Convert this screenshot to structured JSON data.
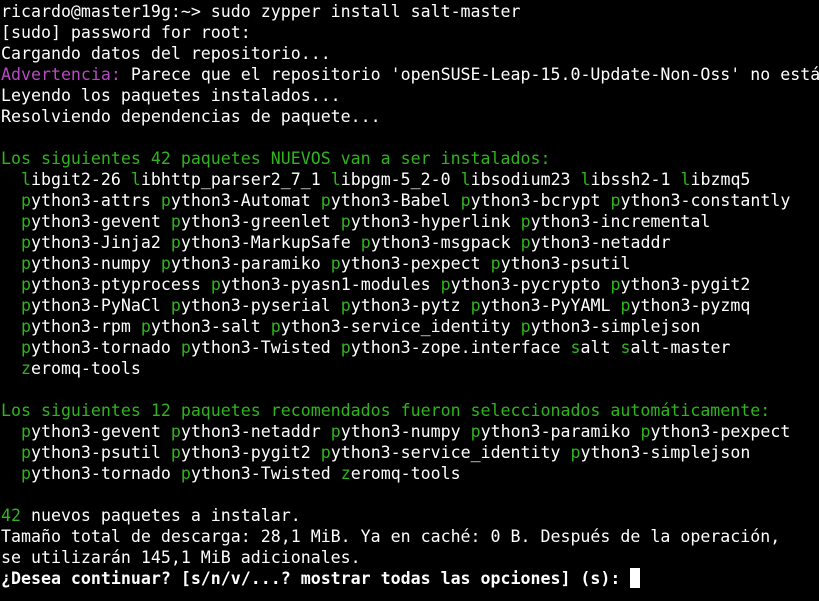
{
  "terminal": {
    "prompt_command": "ricardo@master19g:~> sudo zypper install salt-master",
    "sudo_prompt": "[sudo] password for root:",
    "loading_repo": "Cargando datos del repositorio...",
    "warning_label": "Advertencia:",
    "warning_text": " Parece que el repositorio 'openSUSE-Leap-15.0-Update-Non-Oss' no está",
    "reading_installed": "Leyendo los paquetes instalados...",
    "resolving_deps": "Resolviendo dependencias de paquete...",
    "new_packages_header": "Los siguientes 42 paquetes NUEVOS van a ser instalados:",
    "new_packages_rows": [
      [
        "libgit2-26",
        "libhttp_parser2_7_1",
        "libpgm-5_2-0",
        "libsodium23",
        "libssh2-1",
        "libzmq5"
      ],
      [
        "python3-attrs",
        "python3-Automat",
        "python3-Babel",
        "python3-bcrypt",
        "python3-constantly"
      ],
      [
        "python3-gevent",
        "python3-greenlet",
        "python3-hyperlink",
        "python3-incremental"
      ],
      [
        "python3-Jinja2",
        "python3-MarkupSafe",
        "python3-msgpack",
        "python3-netaddr"
      ],
      [
        "python3-numpy",
        "python3-paramiko",
        "python3-pexpect",
        "python3-psutil"
      ],
      [
        "python3-ptyprocess",
        "python3-pyasn1-modules",
        "python3-pycrypto",
        "python3-pygit2"
      ],
      [
        "python3-PyNaCl",
        "python3-pyserial",
        "python3-pytz",
        "python3-PyYAML",
        "python3-pyzmq"
      ],
      [
        "python3-rpm",
        "python3-salt",
        "python3-service_identity",
        "python3-simplejson"
      ],
      [
        "python3-tornado",
        "python3-Twisted",
        "python3-zope.interface",
        "salt",
        "salt-master"
      ],
      [
        "zeromq-tools"
      ]
    ],
    "recommended_header": "Los siguientes 12 paquetes recomendados fueron seleccionados automáticamente:",
    "recommended_rows": [
      [
        "python3-gevent",
        "python3-netaddr",
        "python3-numpy",
        "python3-paramiko",
        "python3-pexpect"
      ],
      [
        "python3-psutil",
        "python3-pygit2",
        "python3-service_identity",
        "python3-simplejson"
      ],
      [
        "python3-tornado",
        "python3-Twisted",
        "zeromq-tools"
      ]
    ],
    "new_count": "42",
    "new_count_text": " nuevos paquetes a instalar.",
    "download_size": "Tamaño total de descarga: 28,1 MiB. Ya en caché: 0 B. Después de la operación,",
    "additional_space": "se utilizarán 145,1 MiB adicionales.",
    "continue_prompt": "¿Desea continuar? [s/n/v/...? mostrar todas las opciones] (s): "
  },
  "colors": {
    "background": "#000000",
    "text": "#ffffff",
    "green": "#2fb41d",
    "magenta": "#b64ac1"
  }
}
